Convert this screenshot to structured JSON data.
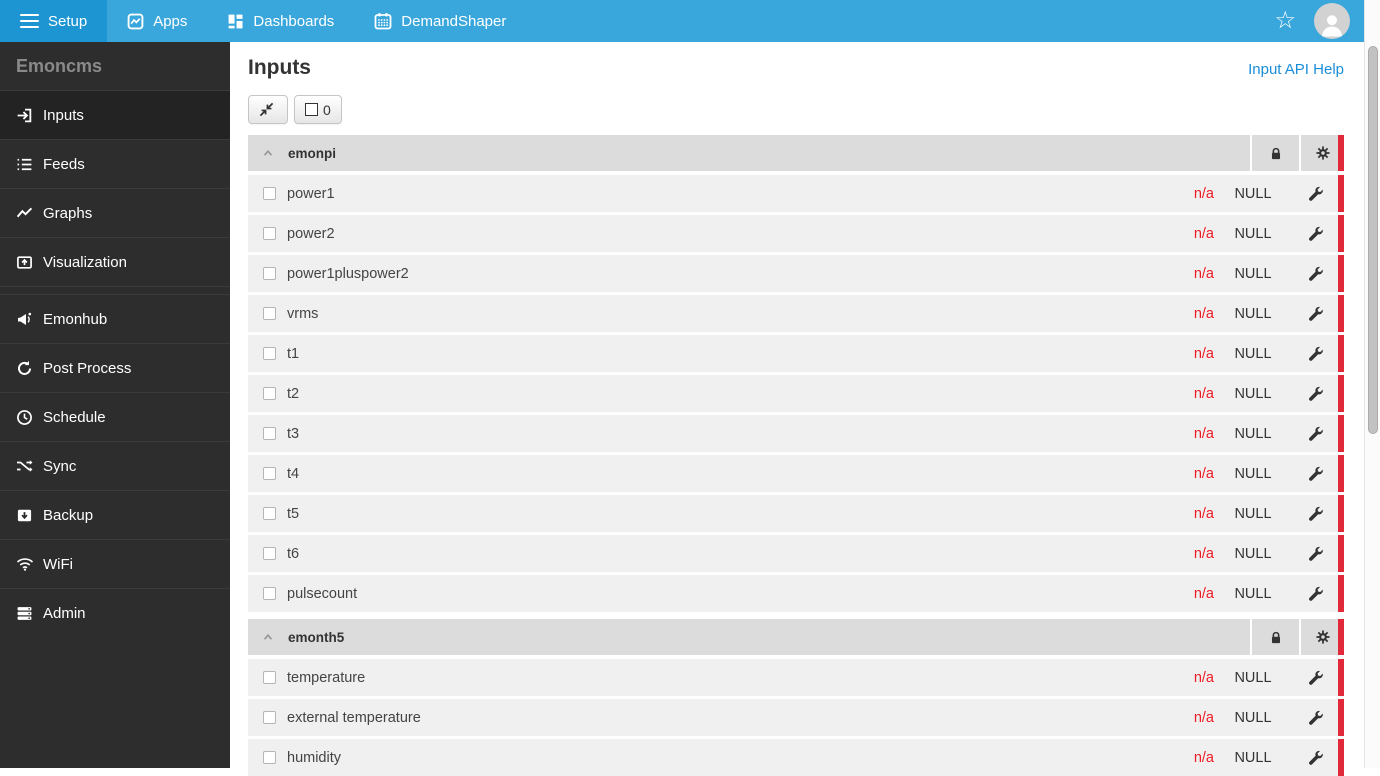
{
  "navbar": {
    "tabs": [
      {
        "label": "Setup",
        "icon": "menu-icon",
        "active": true
      },
      {
        "label": "Apps",
        "icon": "apps-icon",
        "active": false
      },
      {
        "label": "Dashboards",
        "icon": "dashboards-icon",
        "active": false
      },
      {
        "label": "DemandShaper",
        "icon": "calendar-icon",
        "active": false
      }
    ],
    "star_icon": "☆"
  },
  "sidebar": {
    "title": "Emoncms",
    "items": [
      {
        "label": "Inputs",
        "icon": "sign-in-icon",
        "active": true,
        "divider_after": false
      },
      {
        "label": "Feeds",
        "icon": "list-icon",
        "active": false,
        "divider_after": false
      },
      {
        "label": "Graphs",
        "icon": "chart-line-icon",
        "active": false,
        "divider_after": false
      },
      {
        "label": "Visualization",
        "icon": "visualization-icon",
        "active": false,
        "divider_after": true
      },
      {
        "label": "Emonhub",
        "icon": "bullhorn-icon",
        "active": false,
        "divider_after": false
      },
      {
        "label": "Post Process",
        "icon": "refresh-icon",
        "active": false,
        "divider_after": false
      },
      {
        "label": "Schedule",
        "icon": "clock-icon",
        "active": false,
        "divider_after": false
      },
      {
        "label": "Sync",
        "icon": "shuffle-icon",
        "active": false,
        "divider_after": false
      },
      {
        "label": "Backup",
        "icon": "backup-icon",
        "active": false,
        "divider_after": false
      },
      {
        "label": "WiFi",
        "icon": "wifi-icon",
        "active": false,
        "divider_after": false
      },
      {
        "label": "Admin",
        "icon": "admin-icon",
        "active": false,
        "divider_after": false
      }
    ]
  },
  "main": {
    "title": "Inputs",
    "api_help_label": "Input API Help",
    "toolbar": {
      "selected_count": "0"
    }
  },
  "inputs_table": {
    "groups": [
      {
        "name": "emonpi",
        "rows": [
          {
            "name": "power1",
            "value": "n/a",
            "status": "NULL"
          },
          {
            "name": "power2",
            "value": "n/a",
            "status": "NULL"
          },
          {
            "name": "power1pluspower2",
            "value": "n/a",
            "status": "NULL"
          },
          {
            "name": "vrms",
            "value": "n/a",
            "status": "NULL"
          },
          {
            "name": "t1",
            "value": "n/a",
            "status": "NULL"
          },
          {
            "name": "t2",
            "value": "n/a",
            "status": "NULL"
          },
          {
            "name": "t3",
            "value": "n/a",
            "status": "NULL"
          },
          {
            "name": "t4",
            "value": "n/a",
            "status": "NULL"
          },
          {
            "name": "t5",
            "value": "n/a",
            "status": "NULL"
          },
          {
            "name": "t6",
            "value": "n/a",
            "status": "NULL"
          },
          {
            "name": "pulsecount",
            "value": "n/a",
            "status": "NULL"
          }
        ]
      },
      {
        "name": "emonth5",
        "rows": [
          {
            "name": "temperature",
            "value": "n/a",
            "status": "NULL"
          },
          {
            "name": "external temperature",
            "value": "n/a",
            "status": "NULL"
          },
          {
            "name": "humidity",
            "value": "n/a",
            "status": "NULL"
          }
        ]
      }
    ]
  },
  "colors": {
    "navbar_blue": "#3aa7dc",
    "active_tab_blue": "#1d95d2",
    "sidebar_dark": "#2d2d2d",
    "row_gray": "#f0f0f0",
    "group_header_gray": "#dcdcdc",
    "red_bar": "#e2293a",
    "value_red": "#ed1c24",
    "link_blue": "#1a8ed8"
  }
}
